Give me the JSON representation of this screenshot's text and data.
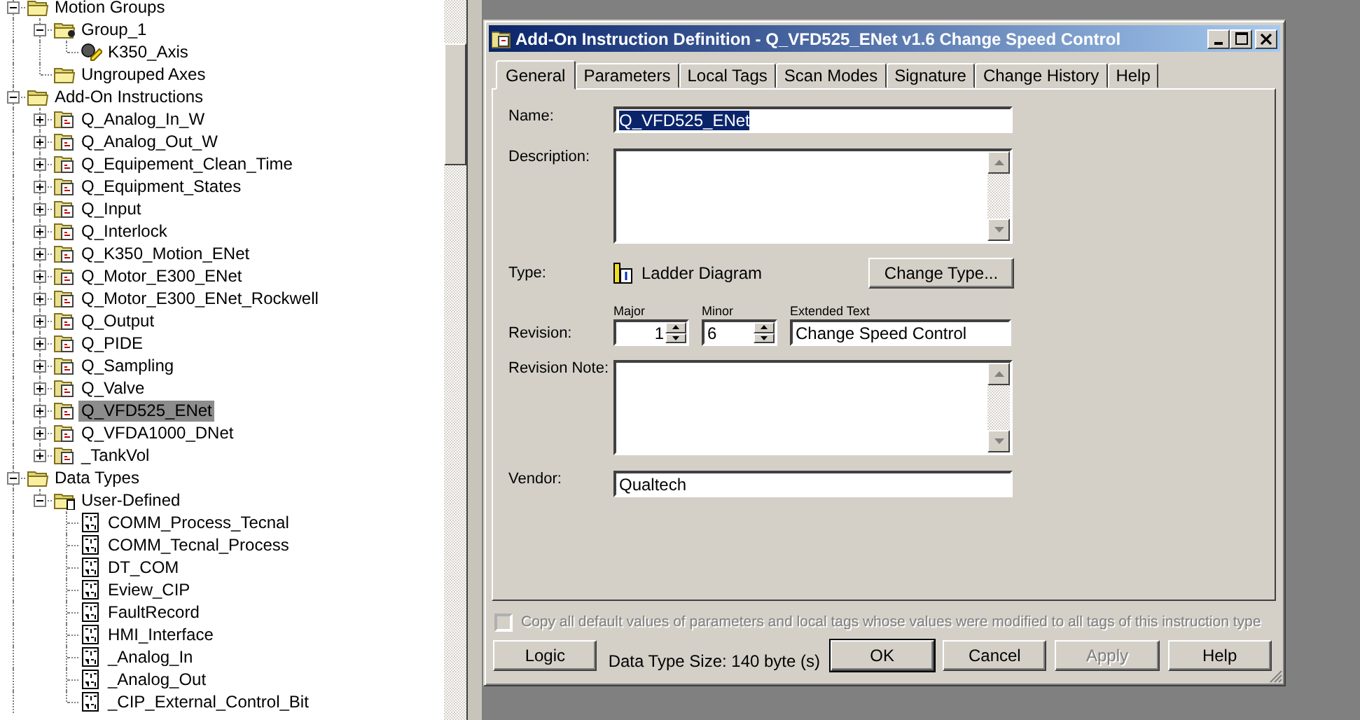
{
  "tree": [
    {
      "label": "Motion Groups",
      "kind": "folder",
      "expanded": true,
      "selected": false,
      "children": [
        {
          "label": "Group_1",
          "kind": "folder-gear",
          "expanded": true,
          "selected": false,
          "children": [
            {
              "label": "K350_Axis",
              "kind": "axis",
              "selected": false
            }
          ]
        },
        {
          "label": "Ungrouped Axes",
          "kind": "folder",
          "selected": false
        }
      ]
    },
    {
      "label": "Add-On Instructions",
      "kind": "folder",
      "expanded": true,
      "selected": false,
      "children": [
        {
          "label": "Q_Analog_In_W",
          "kind": "aoi",
          "expanded": false,
          "selected": false
        },
        {
          "label": "Q_Analog_Out_W",
          "kind": "aoi",
          "expanded": false,
          "selected": false
        },
        {
          "label": "Q_Equipement_Clean_Time",
          "kind": "aoi",
          "expanded": false,
          "selected": false
        },
        {
          "label": "Q_Equipment_States",
          "kind": "aoi",
          "expanded": false,
          "selected": false
        },
        {
          "label": "Q_Input",
          "kind": "aoi",
          "expanded": false,
          "selected": false
        },
        {
          "label": "Q_Interlock",
          "kind": "aoi",
          "expanded": false,
          "selected": false
        },
        {
          "label": "Q_K350_Motion_ENet",
          "kind": "aoi",
          "expanded": false,
          "selected": false
        },
        {
          "label": "Q_Motor_E300_ENet",
          "kind": "aoi",
          "expanded": false,
          "selected": false
        },
        {
          "label": "Q_Motor_E300_ENet_Rockwell",
          "kind": "aoi",
          "expanded": false,
          "selected": false
        },
        {
          "label": "Q_Output",
          "kind": "aoi",
          "expanded": false,
          "selected": false
        },
        {
          "label": "Q_PIDE",
          "kind": "aoi",
          "expanded": false,
          "selected": false
        },
        {
          "label": "Q_Sampling",
          "kind": "aoi",
          "expanded": false,
          "selected": false
        },
        {
          "label": "Q_Valve",
          "kind": "aoi",
          "expanded": false,
          "selected": false
        },
        {
          "label": "Q_VFD525_ENet",
          "kind": "aoi",
          "expanded": false,
          "selected": true
        },
        {
          "label": "Q_VFDA1000_DNet",
          "kind": "aoi",
          "expanded": false,
          "selected": false
        },
        {
          "label": "_TankVol",
          "kind": "aoi",
          "expanded": false,
          "selected": false
        }
      ]
    },
    {
      "label": "Data Types",
      "kind": "folder",
      "expanded": true,
      "selected": false,
      "children": [
        {
          "label": "User-Defined",
          "kind": "datatype-folder",
          "expanded": true,
          "selected": false,
          "children": [
            {
              "label": "COMM_Process_Tecnal",
              "kind": "datatype",
              "selected": false
            },
            {
              "label": "COMM_Tecnal_Process",
              "kind": "datatype",
              "selected": false
            },
            {
              "label": "DT_COM",
              "kind": "datatype",
              "selected": false
            },
            {
              "label": "Eview_CIP",
              "kind": "datatype",
              "selected": false
            },
            {
              "label": "FaultRecord",
              "kind": "datatype",
              "selected": false
            },
            {
              "label": "HMI_Interface",
              "kind": "datatype",
              "selected": false
            },
            {
              "label": "_Analog_In",
              "kind": "datatype",
              "selected": false
            },
            {
              "label": "_Analog_Out",
              "kind": "datatype",
              "selected": false
            },
            {
              "label": "_CIP_External_Control_Bit",
              "kind": "datatype",
              "selected": false
            }
          ]
        }
      ]
    }
  ],
  "dialog": {
    "title": "Add-On Instruction Definition - Q_VFD525_ENet v1.6 Change Speed Control",
    "tabs": [
      {
        "label": "General",
        "selected": true
      },
      {
        "label": "Parameters",
        "selected": false
      },
      {
        "label": "Local Tags",
        "selected": false
      },
      {
        "label": "Scan Modes",
        "selected": false
      },
      {
        "label": "Signature",
        "selected": false
      },
      {
        "label": "Change History",
        "selected": false
      },
      {
        "label": "Help",
        "selected": false
      }
    ],
    "name": {
      "label": "Name:",
      "value": "Q_VFD525_ENet",
      "selected": true
    },
    "description": {
      "label": "Description:"
    },
    "type": {
      "label": "Type:",
      "value": "Ladder Diagram",
      "button": "Change Type..."
    },
    "revision": {
      "label": "Revision:",
      "major_label": "Major",
      "major_value": "1",
      "minor_label": "Minor",
      "minor_value": "6",
      "extended_label": "Extended Text",
      "extended_value": "Change Speed Control"
    },
    "revision_note": {
      "label": "Revision Note:"
    },
    "vendor": {
      "label": "Vendor:",
      "value": "Qualtech"
    },
    "copy_checkbox": {
      "label": "Copy all default values of parameters and local tags whose values were modified to all tags of this instruction type",
      "checked": false,
      "disabled": true
    },
    "logic_button": "Logic",
    "data_type_size": "Data Type Size: 140 byte (s)",
    "buttons": [
      {
        "label": "OK",
        "default": true,
        "disabled": false
      },
      {
        "label": "Cancel",
        "default": false,
        "disabled": false
      },
      {
        "label": "Apply",
        "default": false,
        "disabled": true
      },
      {
        "label": "Help",
        "default": false,
        "disabled": false
      }
    ]
  }
}
